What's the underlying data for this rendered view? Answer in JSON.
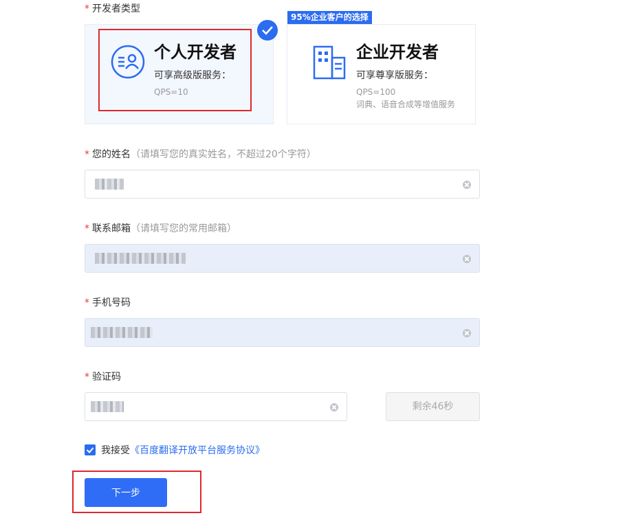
{
  "developer_type": {
    "label": "开发者类型",
    "required_mark": "*",
    "promo_tag": "95%企业客户的选择",
    "personal": {
      "title": "个人开发者",
      "service": "可享高级版服务：",
      "qps": "QPS=10",
      "icon": "personal-developer-icon",
      "selected": true
    },
    "enterprise": {
      "title": "企业开发者",
      "service": "可享尊享版服务：",
      "qps": "QPS=100",
      "extra": "词典、语音合成等增值服务",
      "icon": "building-icon"
    }
  },
  "name_field": {
    "required_mark": "*",
    "label": "您的姓名",
    "hint": "（请填写您的真实姓名，不超过20个字符）"
  },
  "email_field": {
    "required_mark": "*",
    "label": "联系邮箱",
    "hint": "（请填写您的常用邮箱）"
  },
  "phone_field": {
    "required_mark": "*",
    "label": "手机号码"
  },
  "code_field": {
    "required_mark": "*",
    "label": "验证码",
    "countdown": "剩余46秒"
  },
  "agreement": {
    "prefix": "我接受",
    "link": "《百度翻译开放平台服务协议》",
    "checked": true
  },
  "next_button": "下一步",
  "colors": {
    "accent": "#2b6cf0",
    "required": "#e53935",
    "highlight_box": "#e0262d",
    "selected_card_bg": "#f3f7fe"
  }
}
